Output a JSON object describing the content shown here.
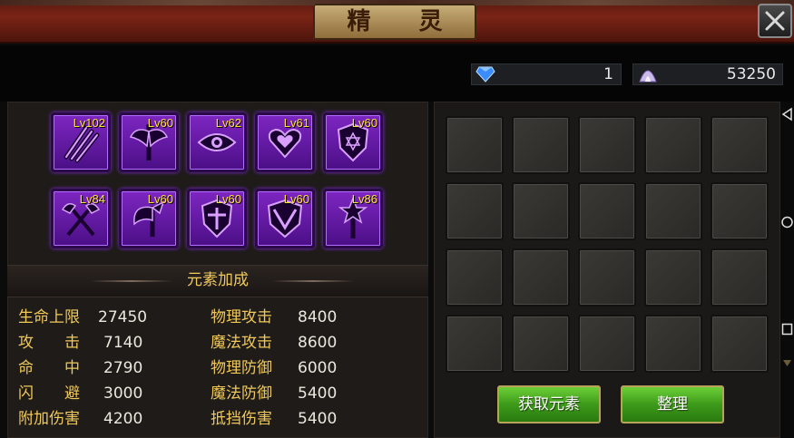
{
  "title": "精 灵",
  "currency": {
    "diamond": "1",
    "crystal": "53250"
  },
  "skills": [
    {
      "level": "Lv102",
      "icon": "claw-slash-icon"
    },
    {
      "level": "Lv60",
      "icon": "winged-sword-icon"
    },
    {
      "level": "Lv62",
      "icon": "eye-icon"
    },
    {
      "level": "Lv61",
      "icon": "heart-icon"
    },
    {
      "level": "Lv60",
      "icon": "hexagram-shield-icon"
    },
    {
      "level": "Lv84",
      "icon": "crossed-axes-icon"
    },
    {
      "level": "Lv60",
      "icon": "war-axe-icon"
    },
    {
      "level": "Lv60",
      "icon": "cross-shield-icon"
    },
    {
      "level": "Lv60",
      "icon": "v-shield-icon"
    },
    {
      "level": "Lv86",
      "icon": "star-staff-icon"
    }
  ],
  "section_title": "元素加成",
  "stats_left": [
    {
      "label": "生命上限",
      "value": "27450"
    },
    {
      "label": "攻　　击",
      "value": "7140"
    },
    {
      "label": "命　　中",
      "value": "2790"
    },
    {
      "label": "闪　　避",
      "value": "3000"
    },
    {
      "label": "附加伤害",
      "value": "4200"
    }
  ],
  "stats_right": [
    {
      "label": "物理攻击",
      "value": "8400"
    },
    {
      "label": "魔法攻击",
      "value": "8600"
    },
    {
      "label": "物理防御",
      "value": "6000"
    },
    {
      "label": "魔法防御",
      "value": "5400"
    },
    {
      "label": "抵挡伤害",
      "value": "5400"
    }
  ],
  "buttons": {
    "obtain": "获取元素",
    "organize": "整理"
  },
  "colors": {
    "accent_gold": "#f0c95a",
    "skill_purple": "#7d26c2",
    "button_green": "#3d9a1a",
    "level_yellow": "#ffe23a"
  }
}
